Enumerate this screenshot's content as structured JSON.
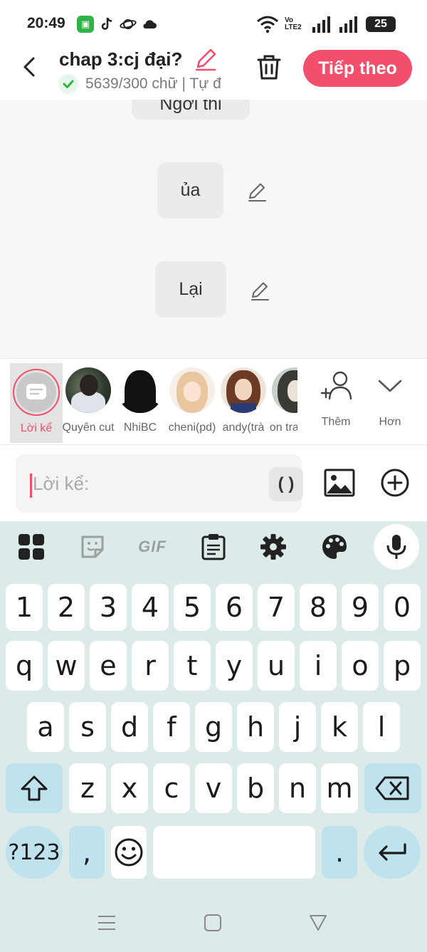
{
  "status_bar": {
    "time": "20:49",
    "network": "Vo LTE2",
    "battery": "25",
    "icons": [
      "green-app-icon",
      "tiktok-icon",
      "planet-icon",
      "cloud-icon",
      "wifi-icon",
      "signal-icon",
      "battery-icon"
    ]
  },
  "header": {
    "title": "chap 3:cj đại?",
    "word_count": "5639/300 chữ | Tự đ",
    "next_label": "Tiếp theo",
    "accent": "#f24f6c"
  },
  "chat": {
    "partial_text": "Ngơi thi",
    "messages": [
      {
        "text": "ủa"
      },
      {
        "text": "Lại"
      }
    ]
  },
  "characters": [
    {
      "name": "Lời kể",
      "selected": true
    },
    {
      "name": "Quyên cut"
    },
    {
      "name": "NhiBC"
    },
    {
      "name": "cheni(pd)"
    },
    {
      "name": "andy(trà"
    },
    {
      "name": "..on tra"
    }
  ],
  "character_actions": {
    "add_label": "Thêm",
    "more_label": "Hơn"
  },
  "input": {
    "placeholder": "Lời kể:",
    "paren_label": "( )"
  },
  "keyboard": {
    "toolbar_icons": [
      "apps-icon",
      "sticker-icon",
      "gif-icon",
      "clipboard-icon",
      "settings-icon",
      "palette-icon",
      "mic-icon"
    ],
    "gif_label": "GIF",
    "rows": [
      [
        "1",
        "2",
        "3",
        "4",
        "5",
        "6",
        "7",
        "8",
        "9",
        "0"
      ],
      [
        "q",
        "w",
        "e",
        "r",
        "t",
        "y",
        "u",
        "i",
        "o",
        "p"
      ],
      [
        "a",
        "s",
        "d",
        "f",
        "g",
        "h",
        "j",
        "k",
        "l"
      ],
      [
        "z",
        "x",
        "c",
        "v",
        "b",
        "n",
        "m"
      ]
    ],
    "symbols_label": "?123",
    "comma_label": ",",
    "period_label": "."
  }
}
